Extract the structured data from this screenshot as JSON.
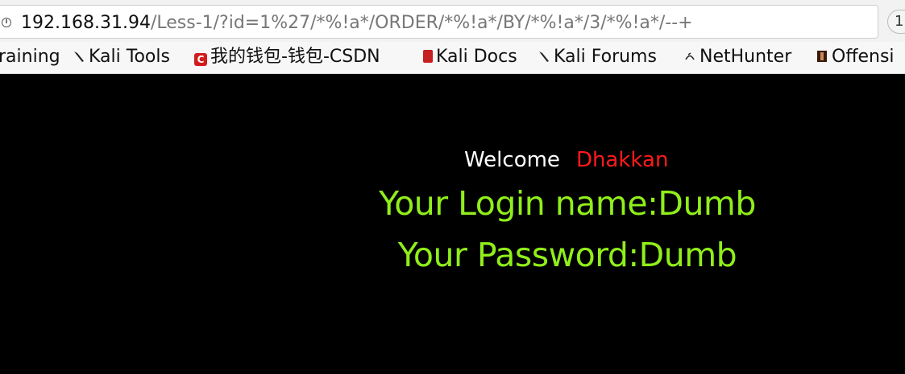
{
  "browser": {
    "url_host": "192.168.31.94",
    "url_path": "/Less-1/?id=1%27/*%!a*/ORDER/*%!a*/BY/*%!a*/3/*%!a*/--+",
    "reader_icon": "1",
    "info_icon": "info-icon"
  },
  "bookmarks": [
    {
      "label": "raining",
      "icon": "none"
    },
    {
      "label": "Kali Tools",
      "icon": "kali-dragon-icon"
    },
    {
      "label": "我的钱包-钱包-CSDN",
      "icon": "csdn-icon"
    },
    {
      "label": "Kali Docs",
      "icon": "kali-docs-icon"
    },
    {
      "label": "Kali Forums",
      "icon": "kali-dragon-icon"
    },
    {
      "label": "NetHunter",
      "icon": "nethunter-icon"
    },
    {
      "label": "Offensi",
      "icon": "offsec-icon"
    }
  ],
  "page": {
    "welcome": "Welcome",
    "user": "Dhakkan",
    "login_name": "Your Login name:Dumb",
    "password": "Your Password:Dumb",
    "colors": {
      "background": "#000000",
      "welcome": "#ffffff",
      "user": "#ff1a1a",
      "result": "#90ee1a"
    }
  }
}
